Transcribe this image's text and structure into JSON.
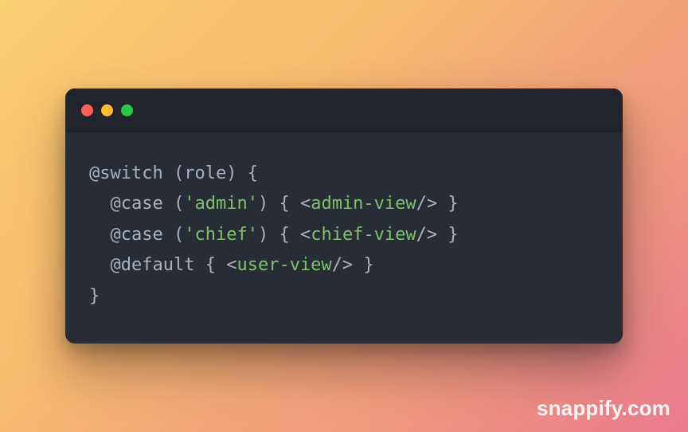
{
  "titlebar": {
    "dots": [
      "close",
      "minimize",
      "maximize"
    ]
  },
  "code": {
    "line1": {
      "switch": "@switch",
      "open_paren": " (",
      "var": "role",
      "close_paren": ") ",
      "brace": "{"
    },
    "line2": {
      "indent": "  ",
      "case": "@case",
      "open_paren": " (",
      "value": "'admin'",
      "close_paren": ") ",
      "brace_open": "{ ",
      "lt": "<",
      "tag": "admin-view",
      "slash_gt": "/>",
      "space_brace": " }"
    },
    "line3": {
      "indent": "  ",
      "case": "@case",
      "open_paren": " (",
      "value": "'chief'",
      "close_paren": ") ",
      "brace_open": "{ ",
      "lt": "<",
      "tag": "chief-view",
      "slash_gt": "/>",
      "space_brace": " }"
    },
    "line4": {
      "indent": "  ",
      "default": "@default",
      "space_brace": " { ",
      "lt": "<",
      "tag": "user-view",
      "slash_gt": "/>",
      "space_brace2": " }"
    },
    "line5": {
      "brace": "}"
    }
  },
  "watermark": "snappify.com"
}
